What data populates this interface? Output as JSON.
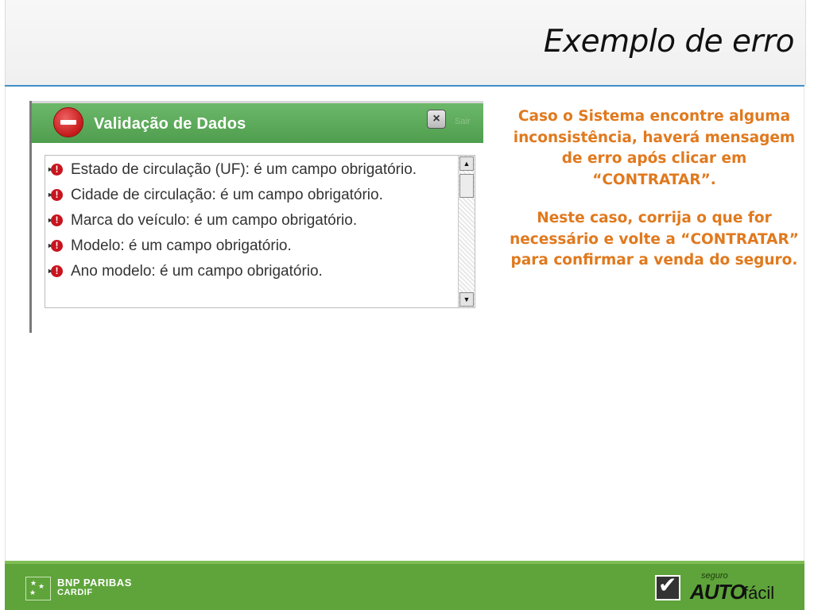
{
  "slide": {
    "title": "Exemplo de erro"
  },
  "dialog": {
    "title": "Validação de Dados",
    "close_label": "Sair",
    "errors": [
      "Estado de circulação (UF): é um campo obrigatório.",
      "Cidade de circulação: é um campo obrigatório.",
      "Marca do veículo: é um campo obrigatório.",
      "Modelo: é um campo obrigatório.",
      "Ano modelo: é um campo obrigatório."
    ]
  },
  "instructions": {
    "paragraph1": "Caso o Sistema encontre alguma inconsistência, haverá mensagem de erro após clicar em “CONTRATAR”.",
    "paragraph2": "Neste caso, corrija o que for necessário e volte a “CONTRATAR” para confirmar a venda do seguro."
  },
  "footer": {
    "brand_line1": "BNP PARIBAS",
    "brand_line2": "CARDIF",
    "product_seguro": "seguro",
    "product_auto": "AUTO",
    "product_facil": "fácil"
  },
  "colors": {
    "accent_orange": "#e0791e",
    "green": "#5ea43a",
    "blue_rule": "#3f8fc9",
    "error_red": "#c8141e"
  },
  "icons": [
    "stop-icon",
    "close-icon",
    "error-icon",
    "scroll-up-icon",
    "scroll-down-icon",
    "bnp-stars-icon",
    "checkmark-icon"
  ]
}
